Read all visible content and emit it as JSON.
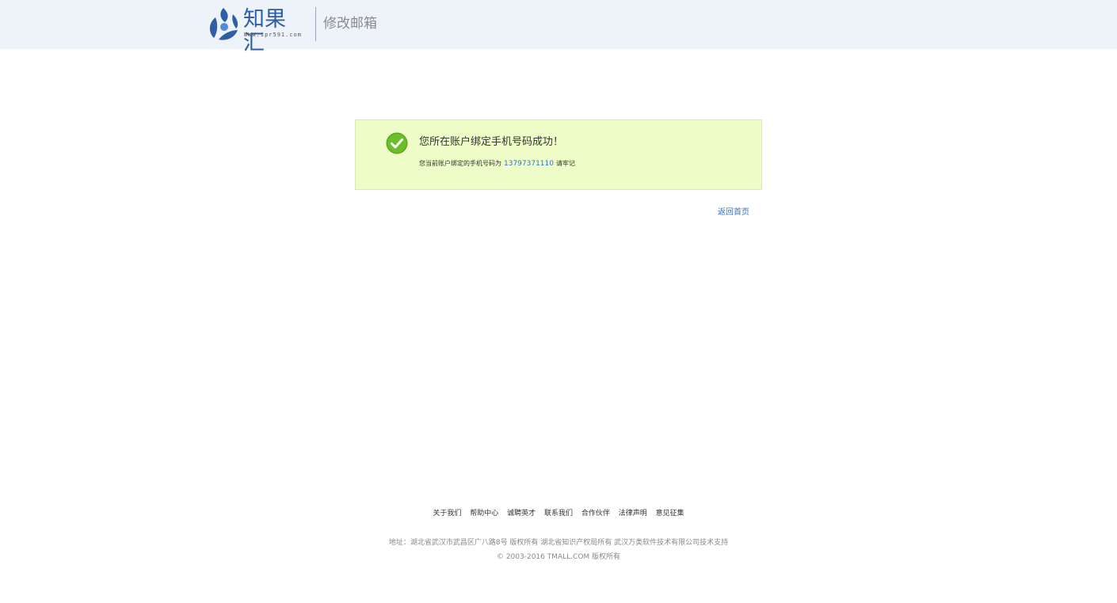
{
  "header": {
    "logo_text": "知果汇",
    "logo_url": "WWW.ipr591.com",
    "title": "修改邮箱"
  },
  "notice": {
    "title": "您所在账户绑定手机号码成功！",
    "detail_prefix": "您当前账户绑定的手机号码为",
    "phone": "13797371110",
    "detail_suffix": "请牢记",
    "icon": "check-circle-icon"
  },
  "back_link": "返回首页",
  "footer": {
    "links": [
      "关于我们",
      "帮助中心",
      "诚聘英才",
      "联系我们",
      "合作伙伴",
      "法律声明",
      "意见征集"
    ],
    "address": "地址：湖北省武汉市武昌区广八路8号 版权所有 湖北省知识产权局所有 武汉万类软件技术有限公司技术支持",
    "copyright": "© 2003-2016 TMALL.COM 版权所有"
  },
  "colors": {
    "header_bg": "#eef3fa",
    "notice_bg": "#eefcc8",
    "accent": "#2f75c2",
    "success": "#5aa51f"
  }
}
